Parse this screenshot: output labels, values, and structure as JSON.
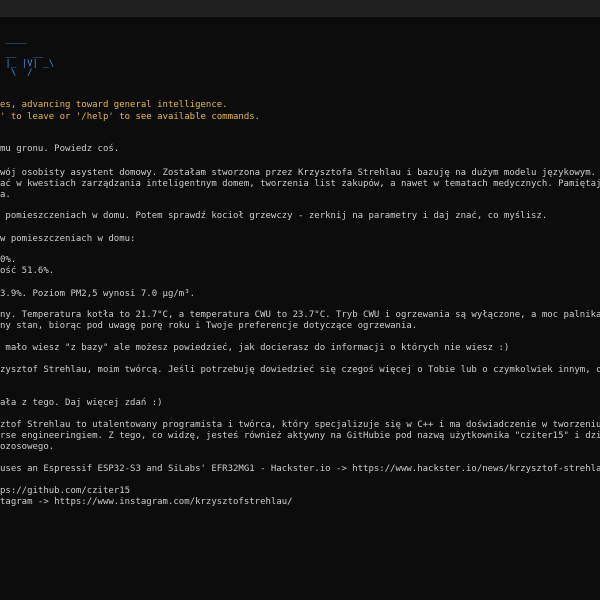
{
  "logo": {
    "row1": " ____",
    "row2": " __   __",
    "row3": " |_ |V| _\\",
    "row4": "  \\  /"
  },
  "intro": {
    "line1": "es, advancing toward general intelligence.",
    "line2": "' to leave or '/help' to see available commands."
  },
  "chat": [
    "mu gronu. Powiedz coś.",
    "wój osobisty asystent domowy. Zostałam stworzona przez Krzysztofa Strehlau i bazuję na dużym modelu językowym. Jest",
    "ać w kwestiach zarządzania inteligentnym domem, tworzenia list zakupów, a nawet w tematach medycznych. Pamiętajcie",
    "a.",
    " pomieszczeniach w domu. Potem sprawdź kocioł grzewczy - zerknij na parametry i daj znać, co myślisz.",
    "w pomieszczeniach w domu:",
    "0%.",
    "ość 51.6%.",
    "3.9%. Poziom PM2,5 wynosi 7.0 µg/m³.",
    "ny. Temperatura kotła to 21.7°C, a temperatura CWU to 23.7°C. Tryb CWU i ogrzewania są wyłączone, a moc palnika wyn",
    "ny stan, biorąc pod uwagę porę roku i Twoje preferencje dotyczące ogrzewania.",
    " mało wiesz \"z bazy\" ale możesz powiedzieć, jak docierasz do informacji o których nie wiesz :)",
    "zysztof Strehlau, moim twórcą. Jeśli potrzebuję dowiedzieć się czegoś więcej o Tobie lub o czymkolwiek innym, czego",
    "ała z tego. Daj więcej zdań :)",
    "ztof Strehlau to utalentowany programista i twórca, który specjalizuje się w C++ i ma doświadczenie w tworzeniu gie",
    "rse engineeringiem. Z tego, co widzę, jesteś również aktywny na GitHubie pod nazwą użytkownika \"cziter15\" i dzielis",
    "ozosowego.",
    "uses an Espressif ESP32-S3 and SiLabs' EFR32MG1 - Hackster.io -> https://www.hackster.io/news/krzysztof-strehlau-s-",
    "ps://github.com/cziter15",
    "tagram -> https://www.instagram.com/krzysztofstrehlau/"
  ]
}
